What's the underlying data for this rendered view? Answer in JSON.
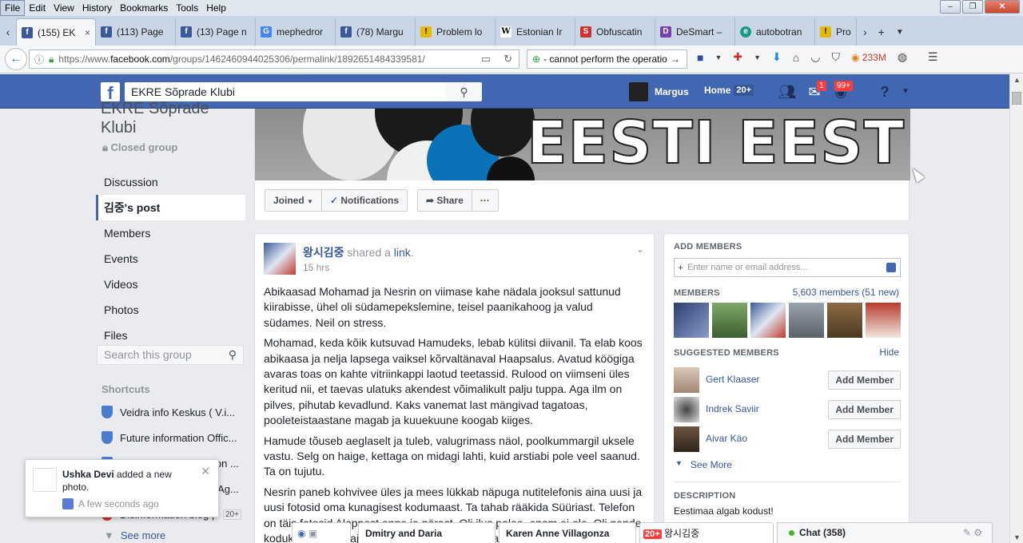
{
  "menubar": [
    "File",
    "Edit",
    "View",
    "History",
    "Bookmarks",
    "Tools",
    "Help"
  ],
  "window_controls": [
    "–",
    "❐",
    "✕"
  ],
  "tabs": [
    {
      "title": "(155) EK",
      "icon": "f",
      "color": "#3b5998",
      "active": true
    },
    {
      "title": "(113) Page",
      "icon": "f",
      "color": "#3b5998"
    },
    {
      "title": "(13) Page n",
      "icon": "f",
      "color": "#3b5998"
    },
    {
      "title": "mephedror",
      "icon": "G",
      "color": "#4285f4"
    },
    {
      "title": "(78) Margu",
      "icon": "f",
      "color": "#3b5998"
    },
    {
      "title": "Problem lo",
      "icon": "!",
      "color": "#e6b800"
    },
    {
      "title": "Estonian Ir",
      "icon": "W",
      "color": "#555555"
    },
    {
      "title": "Obfuscatin",
      "icon": "S",
      "color": "#d0312d"
    },
    {
      "title": "DeSmart –",
      "icon": "D",
      "color": "#7a3fb0"
    },
    {
      "title": "autobotran",
      "icon": "e",
      "color": "#1a9c8a"
    },
    {
      "title": "Pro",
      "icon": "!",
      "color": "#e6b800"
    }
  ],
  "tab_close": "×",
  "url": {
    "prefix": "https://www.",
    "domain": "facebook.com",
    "path": "/groups/1462460944025306/permalink/1892651484339581/"
  },
  "search_bar": {
    "value": "- cannot perform the operatio"
  },
  "memory": "233M",
  "fb": {
    "logo": "f",
    "search_value": "EKRE Sõprade Klubi",
    "user_name": "Margus",
    "home_label": "Home",
    "home_count": "20+",
    "messages_badge": "1",
    "notifications_badge": "99+"
  },
  "group": {
    "title": "EKRE Sõprade Klubi",
    "privacy": "Closed group",
    "nav": [
      "Discussion",
      "김중's post",
      "Members",
      "Events",
      "Videos",
      "Photos",
      "Files"
    ],
    "search_placeholder": "Search this group",
    "shortcuts_heading": "Shortcuts",
    "shortcuts": [
      "Veidra info Keskus ( V.i...",
      "Future information Offic...",
      "Lõhestav informatsioon ...",
      "Authority information Ag...",
      "Disinformation blog | ..."
    ],
    "shortcut_count": "20+",
    "see_more": "See more"
  },
  "cover": {
    "text": "EESTI EEST!"
  },
  "actions": {
    "joined": "Joined",
    "notifications": "Notifications",
    "share": "Share",
    "more": "···"
  },
  "toast": {
    "name": "Ushka Devi",
    "action": " added a new photo.",
    "time": "A few seconds ago"
  },
  "post": {
    "author": "왕시김중",
    "shared": " shared a ",
    "link": "link",
    "time": "15 hrs",
    "paragraphs": [
      "Abikaasad Mohamad ja Nesrin on viimase kahe nädala jooksul sattunud kiirabisse, ühel oli südamepekslemine, teisel paanikahoog ja valud südames. Neil on stress.",
      "Mohamad, keda kõik kutsuvad Hamudeks, lebab külitsi diivanil. Ta elab koos abikaasa ja nelja lapsega vaiksel kõrvaltänaval Haapsalus. Avatud köögiga avaras toas on kahte vitriinkappi laotud teetassid. Rulood on viimseni üles keritud nii, et taevas ulatuks akendest võimalikult palju tuppa. Aga ilm on pilves, pihutab kevadlund. Kaks vanemat last mängivad tagatoas, pooleteistaastane magab ja kuuekuune koogab kiiges.",
      "Hamude tõuseb aeglaselt ja tuleb, valugrimass näol, poolkummargil uksele vastu. Selg on haige, kettaga on midagi lahti, kuid arstiabi pole veel saanud. Ta on tujutu.",
      "Nesrin paneb kohvivee üles ja mees lükkab näpuga nutitelefonis aina uusi ja uusi fotosid oma kunagisest kodumaast. Ta tahab rääkida Süüriast. Telefon on täis fotosid Aleppost enne ja pärast. Oli ilus palee, enam ei ole. Oli nende kodukohas ilus maja, enam ei ole. Nüüd on seal varemed ja surm."
    ]
  },
  "right": {
    "add_members": "ADD MEMBERS",
    "add_placeholder": "Enter name or email address...",
    "members": "MEMBERS",
    "members_count": "5,603 members (51 new)",
    "suggested": "SUGGESTED MEMBERS",
    "hide": "Hide",
    "suggestions": [
      {
        "name": "Gert Klaaser",
        "button": "Add Member"
      },
      {
        "name": "Indrek Saviir",
        "button": "Add Member"
      },
      {
        "name": "Aivar Käo",
        "button": "Add Member"
      }
    ],
    "see_more": "See More",
    "description_heading": "DESCRIPTION",
    "description": "Eestimaa algab kodust!"
  },
  "chat": {
    "tab1": "Dmitry and Daria",
    "tab2": "Karen Anne Villagonza",
    "tab3_badge": "20+",
    "tab3": "왕시김중",
    "main": "Chat (358)"
  }
}
